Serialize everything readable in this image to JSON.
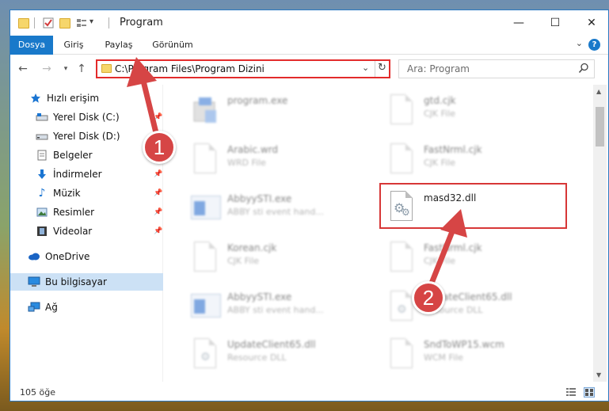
{
  "window": {
    "title": "Program",
    "controls": {
      "minimize": "—",
      "maximize": "☐",
      "close": "✕"
    }
  },
  "ribbon": {
    "tabs": [
      {
        "label": "Dosya",
        "active": true
      },
      {
        "label": "Giriş",
        "active": false
      },
      {
        "label": "Paylaş",
        "active": false
      },
      {
        "label": "Görünüm",
        "active": false
      }
    ],
    "help": "?"
  },
  "navigation": {
    "path": "C:\\Program Files\\Program Dizini",
    "search_placeholder": "Ara: Program"
  },
  "sidebar": {
    "items": [
      {
        "label": "Hızlı erişim",
        "icon": "star-icon",
        "pinned": false
      },
      {
        "label": "Yerel Disk (C:)",
        "icon": "drive-c-icon",
        "pinned": true
      },
      {
        "label": "Yerel Disk (D:)",
        "icon": "drive-d-icon",
        "pinned": true
      },
      {
        "label": "Belgeler",
        "icon": "documents-icon",
        "pinned": true
      },
      {
        "label": "İndirmeler",
        "icon": "download-icon",
        "pinned": true
      },
      {
        "label": "Müzik",
        "icon": "music-icon",
        "pinned": true
      },
      {
        "label": "Resimler",
        "icon": "pictures-icon",
        "pinned": true
      },
      {
        "label": "Videolar",
        "icon": "videos-icon",
        "pinned": true
      },
      {
        "label": "OneDrive",
        "icon": "cloud-icon",
        "pinned": false
      },
      {
        "label": "Bu bilgisayar",
        "icon": "computer-icon",
        "pinned": false,
        "selected": true
      },
      {
        "label": "Ağ",
        "icon": "network-icon",
        "pinned": false
      }
    ]
  },
  "files": [
    {
      "name": "program.exe",
      "desc": "",
      "type": "installer"
    },
    {
      "name": "gtd.cjk",
      "desc": "CJK File",
      "type": "doc"
    },
    {
      "name": "Arabic.wrd",
      "desc": "WRD File",
      "type": "doc"
    },
    {
      "name": "FastNrml.cjk",
      "desc": "CJK File",
      "type": "doc"
    },
    {
      "name": "AbbyySTI.exe",
      "desc": "ABBY sti event hand...",
      "type": "exe"
    },
    {
      "name": "masd32.dll",
      "desc": "",
      "type": "dll"
    },
    {
      "name": "Korean.cjk",
      "desc": "CJK File",
      "type": "doc"
    },
    {
      "name": "FastNrml.cjk",
      "desc": "CJK File",
      "type": "doc"
    },
    {
      "name": "AbbyySTI.exe",
      "desc": "ABBY sti event hand...",
      "type": "exe"
    },
    {
      "name": "UpdateClient65.dll",
      "desc": "Resource DLL",
      "type": "dll"
    },
    {
      "name": "UpdateClient65.dll",
      "desc": "Resource DLL",
      "type": "dll"
    },
    {
      "name": "SndToWP15.wcm",
      "desc": "WCM File",
      "type": "doc"
    }
  ],
  "status": {
    "item_count": "105 öğe"
  },
  "annotations": {
    "badge1": "1",
    "badge2": "2",
    "color": "#d64545"
  }
}
